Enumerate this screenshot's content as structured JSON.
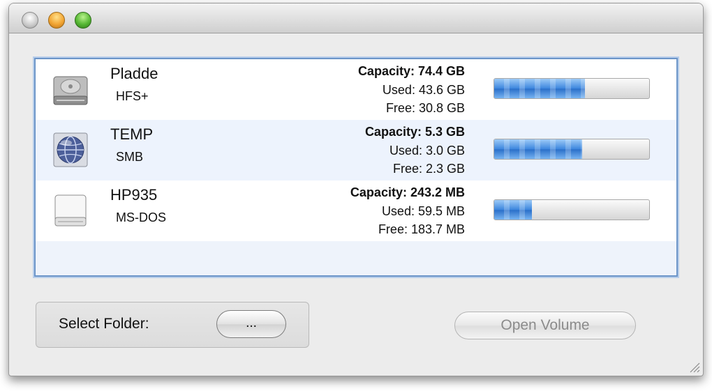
{
  "window": {
    "title": ""
  },
  "volumes": [
    {
      "name": "Pladde",
      "filesystem": "HFS+",
      "icon": "hard-disk-icon",
      "capacity": "Capacity: 74.4 GB",
      "used": "Used: 43.6 GB",
      "free": "Free: 30.8 GB",
      "usage_fraction": 0.586
    },
    {
      "name": "TEMP",
      "filesystem": "SMB",
      "icon": "network-volume-icon",
      "capacity": "Capacity: 5.3 GB",
      "used": "Used: 3.0 GB",
      "free": "Free: 2.3 GB",
      "usage_fraction": 0.566
    },
    {
      "name": "HP935",
      "filesystem": "MS-DOS",
      "icon": "removable-disk-icon",
      "capacity": "Capacity: 243.2 MB",
      "used": "Used: 59.5 MB",
      "free": "Free: 183.7 MB",
      "usage_fraction": 0.245
    }
  ],
  "controls": {
    "select_folder_label": "Select Folder:",
    "browse_label": "...",
    "open_volume_label": "Open Volume",
    "open_volume_enabled": false
  },
  "colors": {
    "selection_border": "#6c95c8",
    "bar_fill": "#3c86de"
  }
}
